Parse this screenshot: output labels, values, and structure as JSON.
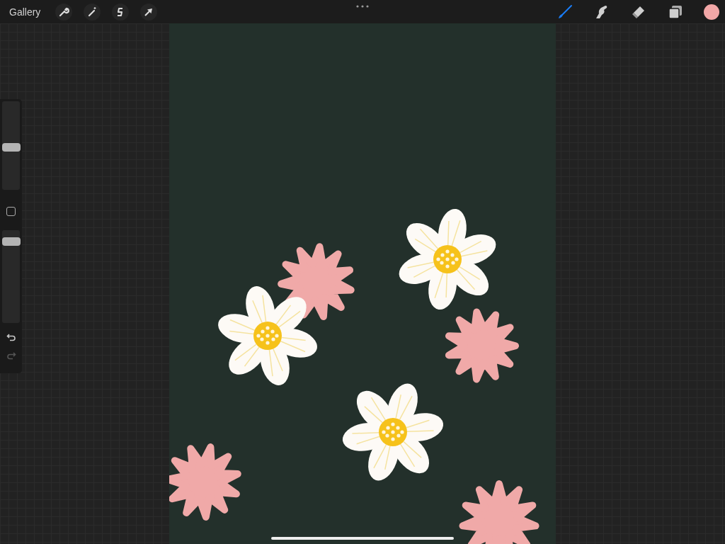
{
  "top_bar": {
    "gallery_label": "Gallery"
  },
  "left_tools": [
    {
      "kind": "wrench",
      "selected": false
    },
    {
      "kind": "wand",
      "selected": false
    },
    {
      "kind": "selection",
      "selected": false
    },
    {
      "kind": "arrow",
      "selected": false
    }
  ],
  "right_tools": [
    {
      "kind": "brush",
      "selected": true
    },
    {
      "kind": "smudge",
      "selected": false
    },
    {
      "kind": "eraser",
      "selected": false
    },
    {
      "kind": "layers",
      "selected": false
    }
  ],
  "color_swatch": {
    "color": "#f2a7a7"
  },
  "sidebar": {
    "brush_size": {
      "level": 0.48
    },
    "opacity": {
      "level": 0.92
    },
    "undo": {
      "disabled": false
    },
    "redo": {
      "disabled": true
    }
  }
}
